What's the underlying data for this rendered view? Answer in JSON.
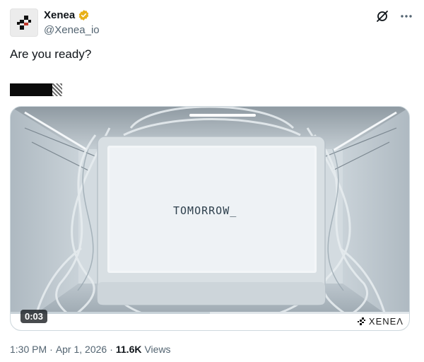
{
  "author": {
    "display_name": "Xenea",
    "handle": "@Xenea_io",
    "verified": true,
    "avatar_icon": "xenea-logo-icon"
  },
  "header_actions": {
    "grok_icon": "slashed-circle-icon",
    "more_icon": "more-horizontal-icon"
  },
  "tweet": {
    "text": "Are you ready?"
  },
  "media": {
    "screen_text": "TOMORROW_",
    "time": "0:03",
    "watermark_text": "XENEΛ",
    "progress_fraction": 0.5
  },
  "meta": {
    "time": "1:30 PM",
    "separator": "·",
    "date": "Apr 1, 2026",
    "views_count": "11.6K",
    "views_label": "Views"
  },
  "colors": {
    "text_primary": "#0f1419",
    "text_secondary": "#536471",
    "verified_gold": "#e8b017",
    "border": "#cfd9de"
  }
}
